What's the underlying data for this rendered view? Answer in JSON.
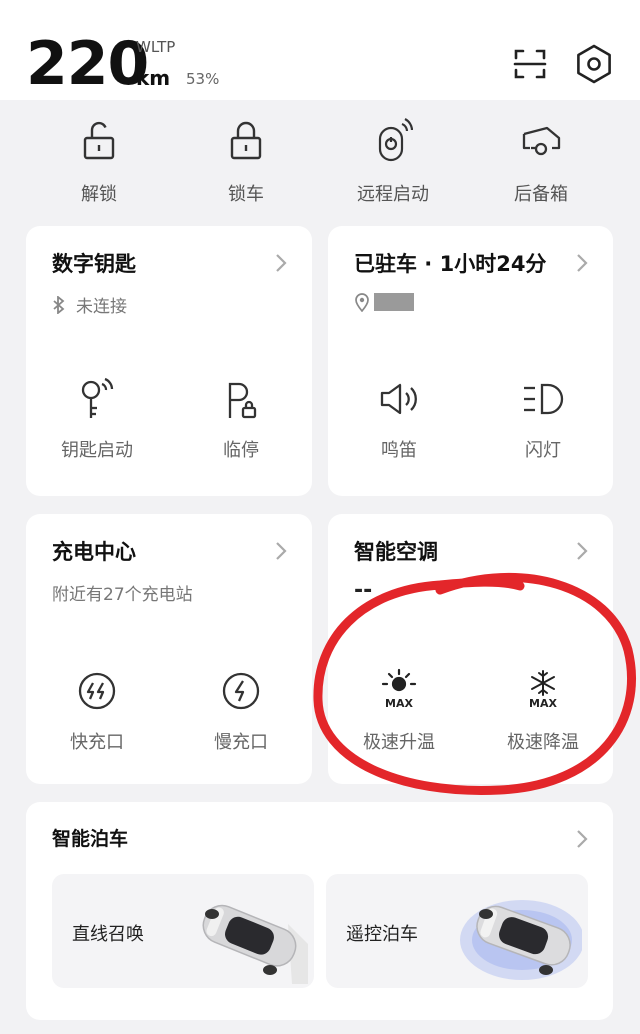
{
  "header": {
    "range_value": "220",
    "range_standard": "WLTP",
    "range_unit": "km",
    "battery_percent": "53%",
    "icons": [
      "scan-icon",
      "settings-icon"
    ]
  },
  "quick_actions": [
    {
      "label": "解锁",
      "icon": "unlock-icon"
    },
    {
      "label": "锁车",
      "icon": "lock-icon"
    },
    {
      "label": "远程启动",
      "icon": "remote-start-icon"
    },
    {
      "label": "后备箱",
      "icon": "trunk-icon"
    }
  ],
  "digital_key": {
    "title": "数字钥匙",
    "status": "未连接",
    "actions": [
      {
        "label": "钥匙启动",
        "icon": "key-start-icon"
      },
      {
        "label": "临停",
        "icon": "temp-parking-icon"
      }
    ]
  },
  "parking": {
    "title": "已驻车 · 1小时24分",
    "actions": [
      {
        "label": "鸣笛",
        "icon": "horn-icon"
      },
      {
        "label": "闪灯",
        "icon": "headlight-icon"
      }
    ]
  },
  "charging": {
    "title": "充电中心",
    "subtitle": "附近有27个充电站",
    "actions": [
      {
        "label": "快充口",
        "icon": "fast-charge-icon"
      },
      {
        "label": "慢充口",
        "icon": "slow-charge-icon"
      }
    ]
  },
  "climate": {
    "title": "智能空调",
    "value": "--",
    "actions": [
      {
        "label": "极速升温",
        "icon": "max-heat-icon",
        "badge": "MAX"
      },
      {
        "label": "极速降温",
        "icon": "max-cool-icon",
        "badge": "MAX"
      }
    ]
  },
  "smart_parking": {
    "title": "智能泊车",
    "tiles": [
      {
        "label": "直线召唤"
      },
      {
        "label": "遥控泊车"
      }
    ]
  },
  "colors": {
    "annotation_red": "#e3262a",
    "background": "#f2f2f4",
    "card": "#ffffff"
  }
}
